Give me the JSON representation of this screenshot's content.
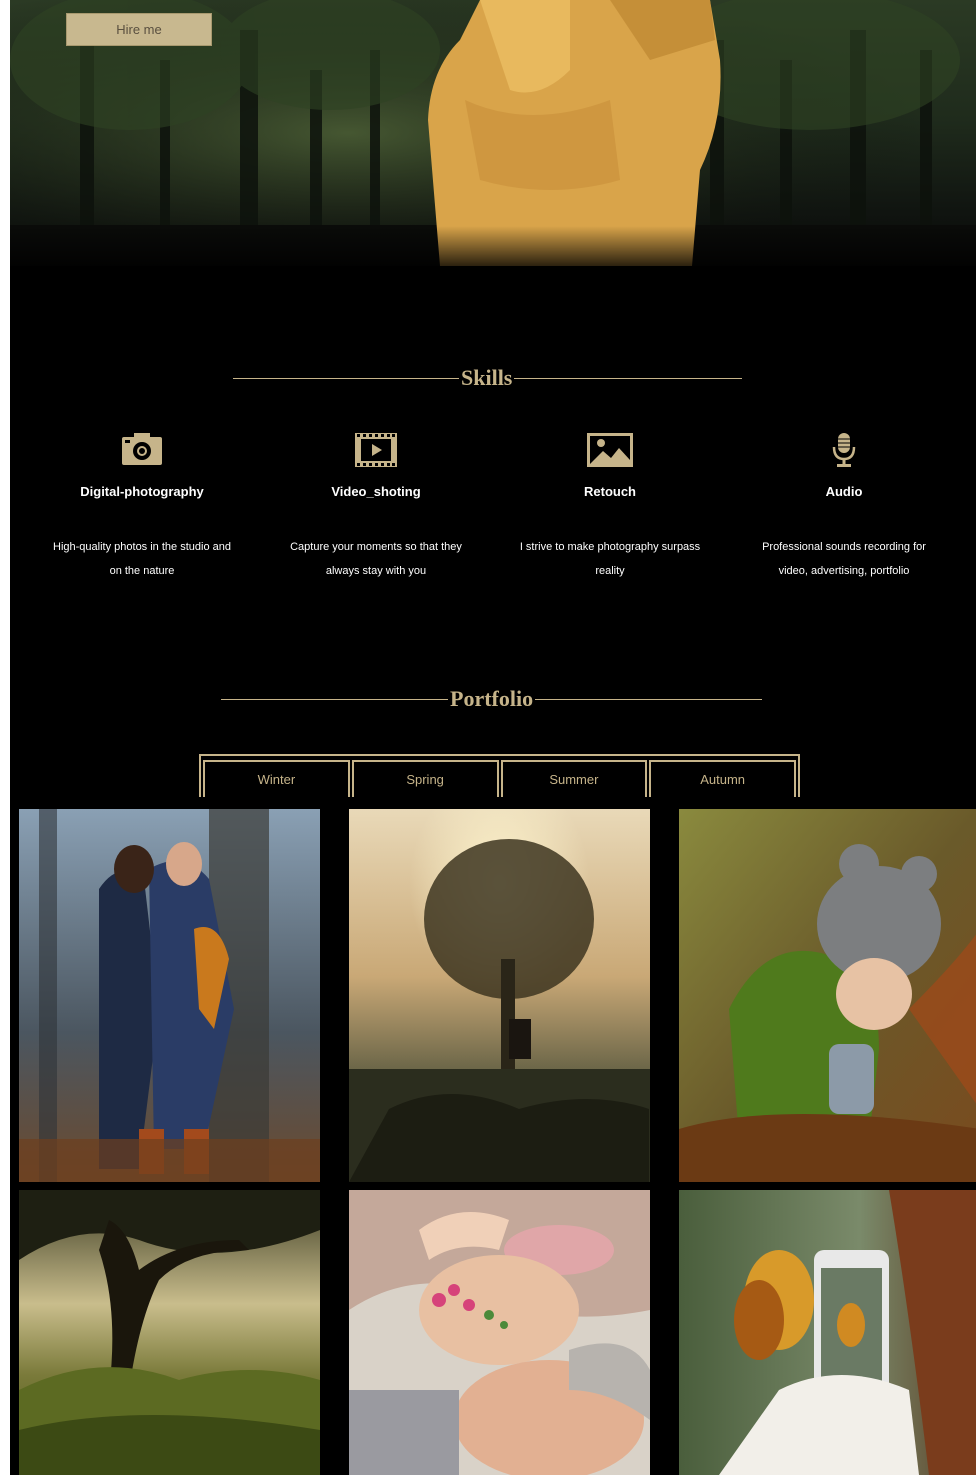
{
  "hero": {
    "hire_label": "Hire me"
  },
  "skills": {
    "title": "Skills",
    "items": [
      {
        "icon": "camera-icon",
        "name": "Digital-photography",
        "desc_line1": "High-quality photos in the studio and",
        "desc_line2": "on the nature"
      },
      {
        "icon": "video-icon",
        "name": "Video_shoting",
        "desc_line1": "Capture your moments so that they",
        "desc_line2": "always stay with you"
      },
      {
        "icon": "image-icon",
        "name": "Retouch",
        "desc_line1": "I strive to make photography surpass",
        "desc_line2": "reality"
      },
      {
        "icon": "microphone-icon",
        "name": "Audio",
        "desc_line1": "Professional sounds recording for",
        "desc_line2": "video, advertising, portfolio"
      }
    ]
  },
  "portfolio": {
    "title": "Portfolio",
    "tabs": [
      "Winter",
      "Spring",
      "Summer",
      "Autumn"
    ]
  },
  "colors": {
    "accent": "#c6b48a",
    "background": "#000000",
    "button": "#c8b88f"
  }
}
